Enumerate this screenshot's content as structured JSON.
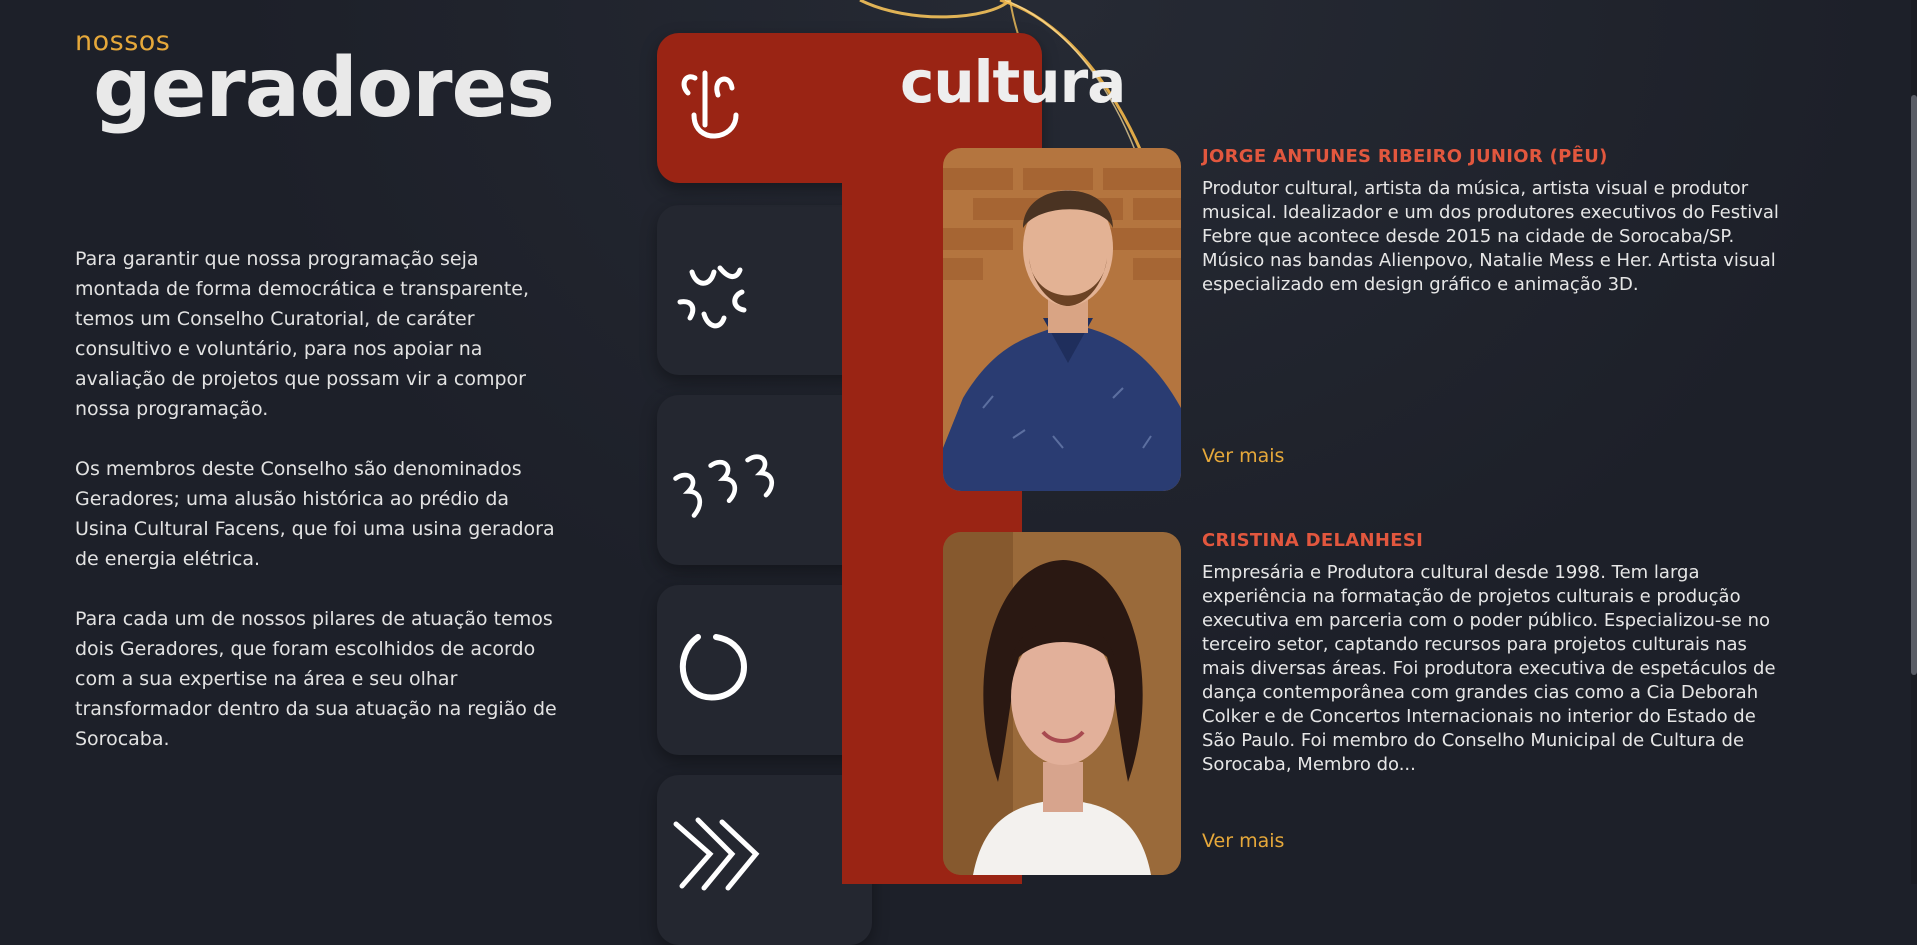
{
  "header": {
    "pre_title": "nossos",
    "title": "geradores"
  },
  "intro": {
    "paragraphs": [
      "Para garantir que nossa programação seja montada de forma democrática e transparente, temos um Conselho Curatorial, de caráter consultivo e voluntário, para nos apoiar na avaliação de projetos que possam vir a compor nossa programação.",
      "Os membros deste Conselho são denominados Geradores; uma alusão histórica ao prédio da Usina Cultural Facens, que foi uma usina geradora de energia elétrica.",
      "Para cada um de nossos pilares de atuação temos dois Geradores, que foram escolhidos de acordo com a sua expertise na área e seu olhar transformador dentro da sua atuação na região de Sorocaba."
    ]
  },
  "pillars": {
    "active_title": "cultura",
    "icons": [
      "face-icon",
      "burst-icon",
      "waves-icon",
      "circle-icon",
      "chevrons-icon"
    ]
  },
  "members": [
    {
      "name": "JORGE ANTUNES RIBEIRO JUNIOR (PÊU)",
      "bio": "Produtor cultural, artista da música, artista visual e produtor musical. Idealizador e um dos produtores executivos do Festival Febre que acontece desde 2015 na cidade de Sorocaba/SP. Músico nas bandas Alienpovo, Natalie Mess e Her. Artista visual especializado em design gráfico e animação 3D.",
      "link": "Ver mais"
    },
    {
      "name": "CRISTINA DELANHESI",
      "bio": "Empresária e Produtora cultural desde 1998. Tem larga experiência na formatação de projetos culturais e produção executiva em parceria com o poder público. Especializou-se no terceiro setor, captando recursos para projetos culturais nas mais diversas áreas. Foi produtora executiva de espetáculos de dança contemporânea com grandes cias como a Cia Deborah Colker e de Concertos Internacionais no interior do Estado de São Paulo. Foi membro do Conselho Municipal de Cultura de Sorocaba, Membro do...",
      "link": "Ver mais"
    }
  ],
  "colors": {
    "background": "#1d2029",
    "accent_red": "#9a2414",
    "accent_orange": "#e6a83a",
    "name_red": "#e2573e"
  }
}
